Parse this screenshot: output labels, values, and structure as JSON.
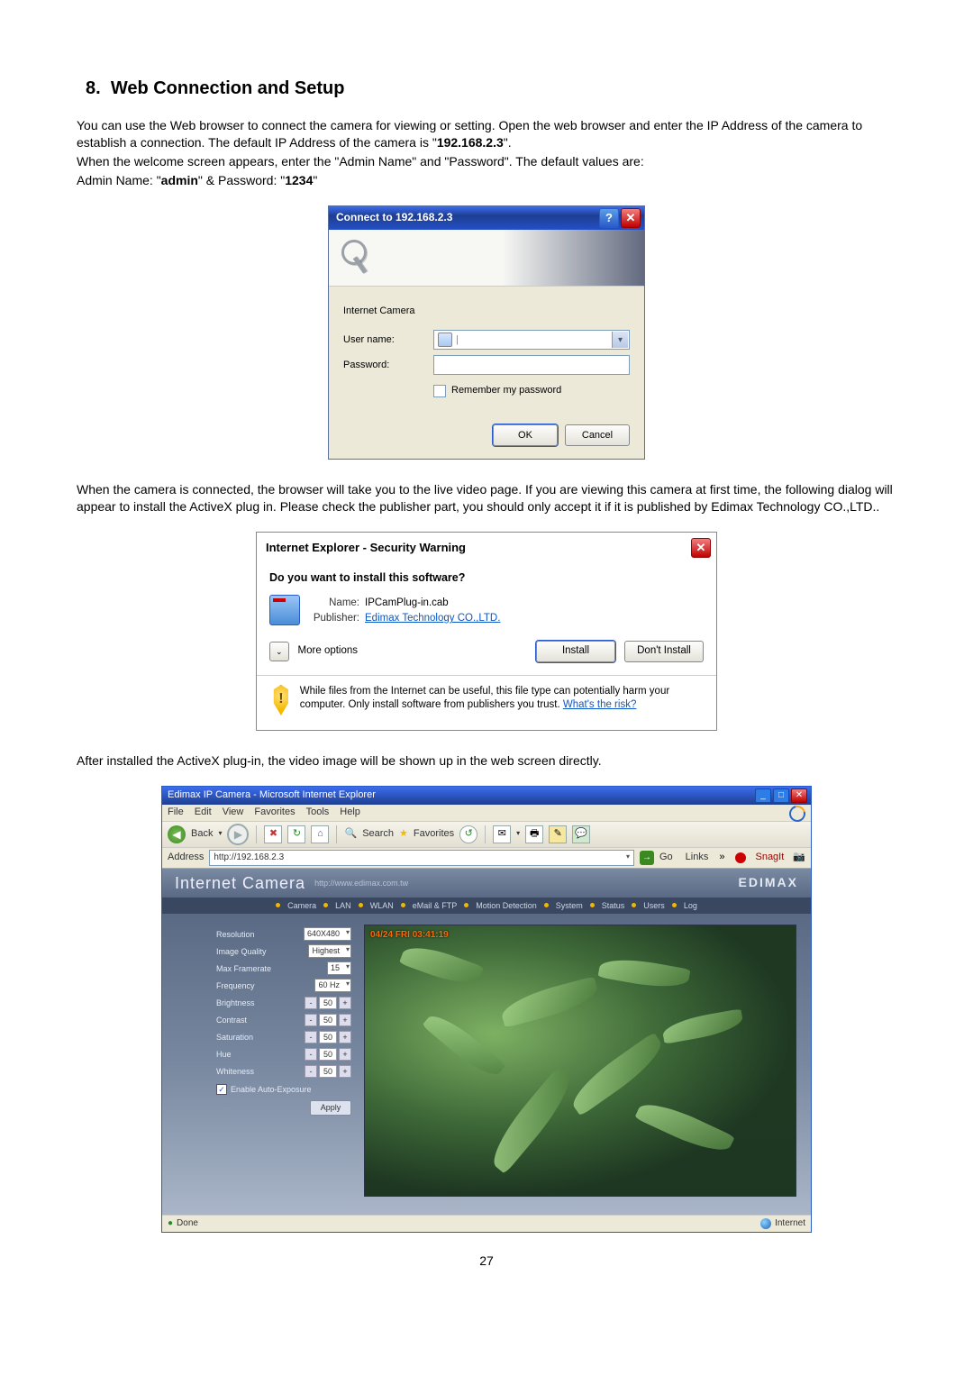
{
  "section": {
    "number": "8.",
    "title": "Web Connection and Setup"
  },
  "intro": {
    "line1": "You can use the Web browser to connect the camera for viewing or setting. Open the web browser and enter the IP Address of the camera to establish a connection. The default IP Address of the camera is \"",
    "ip": "192.168.2.3",
    "line1_end": "\".",
    "line2": "When the welcome screen appears, enter the \"Admin Name\" and \"Password\". The default values are:",
    "line3_a": "Admin Name: \"",
    "admin": "admin",
    "line3_b": "\" & Password: \"",
    "pass": "1234",
    "line3_c": "\""
  },
  "connect_dialog": {
    "title": "Connect to 192.168.2.3",
    "realm": "Internet Camera",
    "username_label": "User name:",
    "password_label": "Password:",
    "username_value": "",
    "remember": "Remember my password",
    "ok": "OK",
    "cancel": "Cancel"
  },
  "mid_para": "When the camera is connected, the browser will take you to the live video page. If you are viewing this camera at first time, the following dialog will appear to install the ActiveX plug in. Please check the publisher part, you should only accept it if it is published by Edimax Technology CO.,LTD..",
  "sec_dialog": {
    "title": "Internet Explorer - Security Warning",
    "question": "Do you want to install this software?",
    "name_label": "Name:",
    "name_value": "IPCamPlug-in.cab",
    "publisher_label": "Publisher:",
    "publisher_value": "Edimax Technology CO.,LTD.",
    "more_options": "More options",
    "install": "Install",
    "dont_install": "Don't Install",
    "warn_text": "While files from the Internet can be useful, this file type can potentially harm your computer. Only install software from publishers you trust. ",
    "risk_link": "What's the risk?"
  },
  "after_para": "After installed the ActiveX plug-in, the video image will be shown up in the web screen directly.",
  "ie": {
    "window_title": "Edimax IP Camera - Microsoft Internet Explorer",
    "menu": [
      "File",
      "Edit",
      "View",
      "Favorites",
      "Tools",
      "Help"
    ],
    "back_label": "Back",
    "toolbar_search": "Search",
    "toolbar_favs": "Favorites",
    "address_label": "Address",
    "address_value": "http://192.168.2.3",
    "go_label": "Go",
    "links_label": "Links",
    "snagit": "SnagIt",
    "header_title": "Internet Camera",
    "header_url": "http://www.edimax.com.tw",
    "brand": "EDIMAX",
    "tabs": [
      "Camera",
      "LAN",
      "WLAN",
      "eMail & FTP",
      "Motion Detection",
      "System",
      "Status",
      "Users",
      "Log"
    ],
    "controls": {
      "resolution": {
        "label": "Resolution",
        "value": "640X480"
      },
      "quality": {
        "label": "Image Quality",
        "value": "Highest"
      },
      "framerate": {
        "label": "Max Framerate",
        "value": "15"
      },
      "frequency": {
        "label": "Frequency",
        "value": "60 Hz"
      },
      "brightness": {
        "label": "Brightness",
        "value": "50"
      },
      "contrast": {
        "label": "Contrast",
        "value": "50"
      },
      "saturation": {
        "label": "Saturation",
        "value": "50"
      },
      "hue": {
        "label": "Hue",
        "value": "50"
      },
      "whiteness": {
        "label": "Whiteness",
        "value": "50"
      },
      "auto_exposure": "Enable Auto-Exposure",
      "apply": "Apply"
    },
    "video_timestamp": "04/24 FRI 03:41:19",
    "status_done": "Done",
    "status_zone": "Internet"
  },
  "page_number": "27"
}
